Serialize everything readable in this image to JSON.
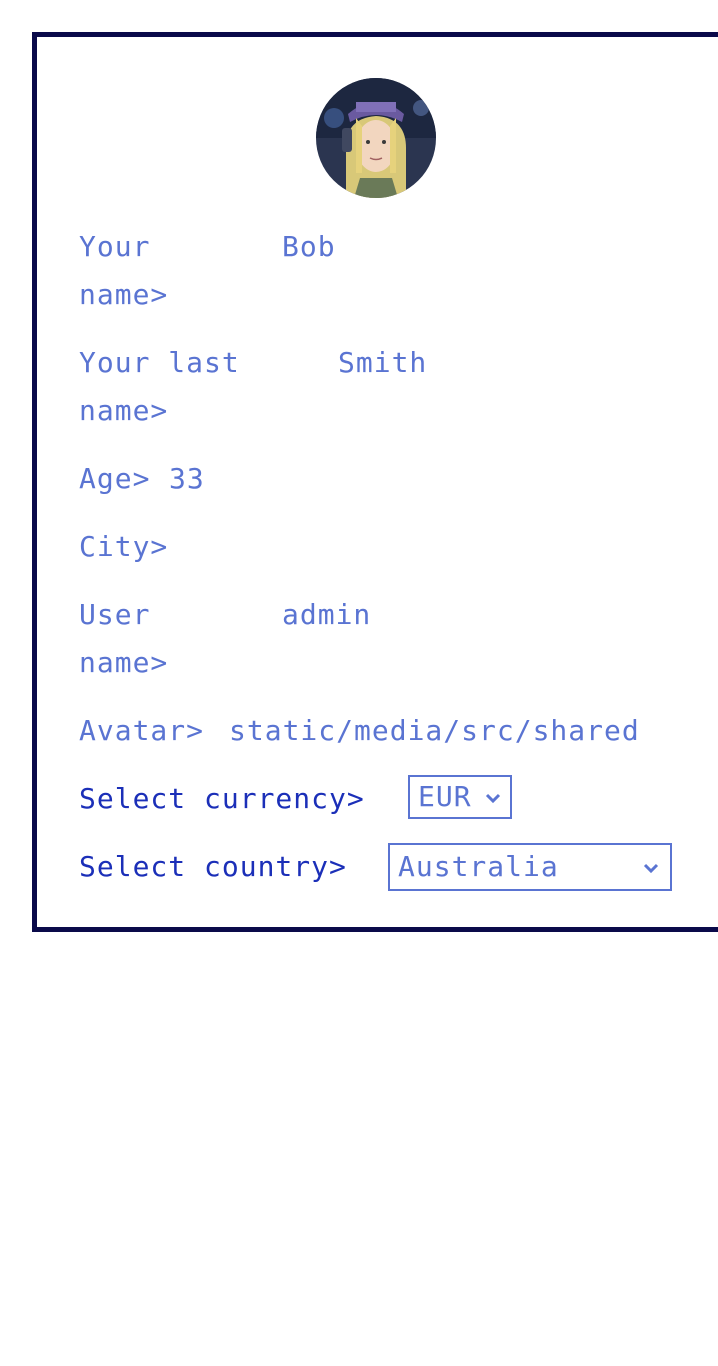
{
  "profile": {
    "avatar_icon": "avatar-image",
    "fields": [
      {
        "label": "Your name>",
        "value": "Bob"
      },
      {
        "label": "Your last name>",
        "value": "Smith"
      },
      {
        "label": "Age>",
        "value": "33"
      },
      {
        "label": "City>",
        "value": ""
      },
      {
        "label": "User name>",
        "value": "admin"
      },
      {
        "label": "Avatar>",
        "value": "static/media/src/shared"
      }
    ],
    "currency": {
      "label": "Select currency>",
      "selected": "EUR"
    },
    "country": {
      "label": "Select country>",
      "selected": "Australia"
    }
  },
  "colors": {
    "border": "#0a0a4a",
    "text": "#5a74d2",
    "label_strong": "#1b2fb8"
  }
}
